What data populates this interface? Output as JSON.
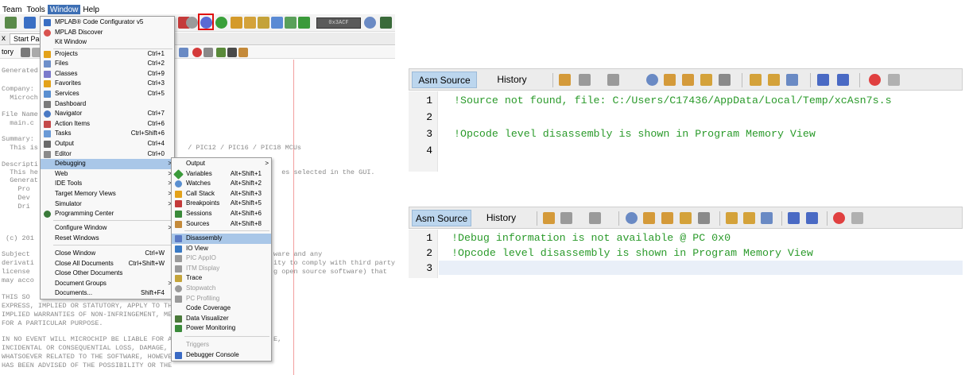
{
  "menubar": {
    "items": [
      {
        "label": "Team"
      },
      {
        "label": "Tools"
      },
      {
        "label": "Window"
      },
      {
        "label": "Help"
      }
    ]
  },
  "tabs": {
    "close": "x",
    "start_page": "Start Page"
  },
  "toolbar2": {
    "label": "tory"
  },
  "toolbar_display": "0x3ACF",
  "editor": {
    "lines": [
      {
        "text": "Generated"
      },
      {
        "text": "Company:"
      },
      {
        "text": "  Microch"
      },
      {
        "text": "File Name"
      },
      {
        "text": "  main.c"
      },
      {
        "text": "Summary:"
      },
      {
        "text": "  This is"
      },
      {
        "text": "  / PIC12 / PIC16 / PIC18 MCUs"
      },
      {
        "text": "Descripti"
      },
      {
        "text": "  This he"
      },
      {
        "text": "  es selected in the GUI."
      },
      {
        "text": "  Generat"
      },
      {
        "text": "    Pro"
      },
      {
        "text": "    Dev"
      },
      {
        "text": "    Dri"
      },
      {
        "text": " (c) 201"
      },
      {
        "text": "Subject "
      },
      {
        "text": "ware and any"
      },
      {
        "text": "derivati"
      },
      {
        "text": "ity to comply with third party"
      },
      {
        "text": "license "
      },
      {
        "text": "g open source software) that"
      },
      {
        "text": "may acco"
      },
      {
        "text": "THIS SO"
      },
      {
        "text": "EXPRESS, IMPLIED OR STATUTORY, APPLY TO THIS"
      },
      {
        "text": "IMPLIED WARRANTIES OF NON-INFRINGEMENT, MER"
      },
      {
        "text": "FOR A PARTICULAR PURPOSE."
      },
      {
        "text": "IN NO EVENT WILL MICROCHIP BE LIABLE FOR AN"
      },
      {
        "text": "E,"
      },
      {
        "text": "INCIDENTAL OR CONSEQUENTIAL LOSS, DAMAGE, C"
      },
      {
        "text": "WHATSOEVER RELATED TO THE SOFTWARE, HOWEVER"
      },
      {
        "text": "HAS BEEN ADVISED OF THE POSSIBILITY OR THE"
      }
    ]
  },
  "window_menu": {
    "items": [
      {
        "label": "MPLAB® Code Configurator v5",
        "shortcut": "",
        "arrow": "",
        "icon": "#3a6fc4"
      },
      {
        "label": "MPLAB Discover",
        "shortcut": "",
        "arrow": "",
        "icon": "#d9534f"
      },
      {
        "label": "Kit Window",
        "shortcut": "",
        "arrow": "",
        "icon": ""
      },
      {
        "label": "Projects",
        "shortcut": "Ctrl+1",
        "arrow": "",
        "icon": "#e3a21a"
      },
      {
        "label": "Files",
        "shortcut": "Ctrl+2",
        "arrow": "",
        "icon": "#6d8fc9"
      },
      {
        "label": "Classes",
        "shortcut": "Ctrl+9",
        "arrow": "",
        "icon": "#7a7acc"
      },
      {
        "label": "Favorites",
        "shortcut": "Ctrl+3",
        "arrow": "",
        "icon": "#e3a21a"
      },
      {
        "label": "Services",
        "shortcut": "Ctrl+5",
        "arrow": "",
        "icon": "#5a8fd0"
      },
      {
        "label": "Dashboard",
        "shortcut": "",
        "arrow": "",
        "icon": "#7a7a7a"
      },
      {
        "label": "Navigator",
        "shortcut": "Ctrl+7",
        "arrow": "",
        "icon": "#4a7ac4"
      },
      {
        "label": "Action Items",
        "shortcut": "Ctrl+6",
        "arrow": "",
        "icon": "#c44a4a"
      },
      {
        "label": "Tasks",
        "shortcut": "Ctrl+Shift+6",
        "arrow": "",
        "icon": "#6a9ad6"
      },
      {
        "label": "Output",
        "shortcut": "Ctrl+4",
        "arrow": "",
        "icon": "#6a6a6a"
      },
      {
        "label": "Editor",
        "shortcut": "Ctrl+0",
        "arrow": "",
        "icon": "#8a8a8a"
      },
      {
        "label": "Debugging",
        "shortcut": "",
        "arrow": ">",
        "icon": "",
        "selected": true
      },
      {
        "label": "Web",
        "shortcut": "",
        "arrow": ">",
        "icon": ""
      },
      {
        "label": "IDE Tools",
        "shortcut": "",
        "arrow": ">",
        "icon": ""
      },
      {
        "label": "Target Memory Views",
        "shortcut": "",
        "arrow": ">",
        "icon": ""
      },
      {
        "label": "Simulator",
        "shortcut": "",
        "arrow": ">",
        "icon": ""
      },
      {
        "label": "Programming Center",
        "shortcut": "",
        "arrow": "",
        "icon": "#3a7a3a"
      },
      {
        "label": "Configure Window",
        "shortcut": "",
        "arrow": ">",
        "icon": ""
      },
      {
        "label": "Reset Windows",
        "shortcut": "",
        "arrow": "",
        "icon": ""
      },
      {
        "label": "Close Window",
        "shortcut": "Ctrl+W",
        "arrow": "",
        "icon": ""
      },
      {
        "label": "Close All Documents",
        "shortcut": "Ctrl+Shift+W",
        "arrow": "",
        "icon": ""
      },
      {
        "label": "Close Other Documents",
        "shortcut": "",
        "arrow": "",
        "icon": ""
      },
      {
        "label": "Document Groups",
        "shortcut": "",
        "arrow": ">",
        "icon": ""
      },
      {
        "label": "Documents...",
        "shortcut": "Shift+F4",
        "arrow": "",
        "icon": ""
      }
    ]
  },
  "debug_menu": {
    "items": [
      {
        "label": "Output",
        "shortcut": "",
        "arrow": ">",
        "icon": ""
      },
      {
        "label": "Variables",
        "shortcut": "Alt+Shift+1",
        "arrow": "",
        "icon": "#3a9a3a"
      },
      {
        "label": "Watches",
        "shortcut": "Alt+Shift+2",
        "arrow": "",
        "icon": "#5a8fd0"
      },
      {
        "label": "Call Stack",
        "shortcut": "Alt+Shift+3",
        "arrow": "",
        "icon": "#e3a21a"
      },
      {
        "label": "Breakpoints",
        "shortcut": "Alt+Shift+5",
        "arrow": "",
        "icon": "#c43a3a"
      },
      {
        "label": "Sessions",
        "shortcut": "Alt+Shift+6",
        "arrow": "",
        "icon": "#3a8a3a"
      },
      {
        "label": "Sources",
        "shortcut": "Alt+Shift+8",
        "arrow": "",
        "icon": "#c48a3a"
      },
      {
        "label": "Disassembly",
        "shortcut": "",
        "arrow": "",
        "icon": "#5a7ac4",
        "selected": true
      },
      {
        "label": "IO View",
        "shortcut": "",
        "arrow": "",
        "icon": "#3a7ac4"
      },
      {
        "label": "PIC AppIO",
        "shortcut": "",
        "arrow": "",
        "icon": "#9a9a9a",
        "disabled": true
      },
      {
        "label": "ITM Display",
        "shortcut": "",
        "arrow": "",
        "icon": "#9a9a9a",
        "disabled": true
      },
      {
        "label": "Trace",
        "shortcut": "",
        "arrow": "",
        "icon": "#c4a43a"
      },
      {
        "label": "Stopwatch",
        "shortcut": "",
        "arrow": "",
        "icon": "#9a9a9a",
        "disabled": true
      },
      {
        "label": "PC Profiling",
        "shortcut": "",
        "arrow": "",
        "icon": "#9a9a9a",
        "disabled": true
      },
      {
        "label": "Code Coverage",
        "shortcut": "",
        "arrow": "",
        "icon": ""
      },
      {
        "label": "Data Visualizer",
        "shortcut": "",
        "arrow": "",
        "icon": "#4a7a3a"
      },
      {
        "label": "Power Monitoring",
        "shortcut": "",
        "arrow": "",
        "icon": "#3a8a3a"
      },
      {
        "label": "Triggers",
        "shortcut": "",
        "arrow": "",
        "icon": "",
        "disabled": true
      },
      {
        "label": "Debugger Console",
        "shortcut": "",
        "arrow": "",
        "icon": "#3a6ac4"
      }
    ]
  },
  "panel1": {
    "tabs": [
      "Asm Source",
      "History"
    ],
    "line_numbers": [
      "1",
      "2",
      "3",
      "4"
    ],
    "lines": [
      "!Source not found, file: C:/Users/C17436/AppData/Local/Temp/xcAsn7s.s",
      "",
      "!Opcode level disassembly is shown in Program Memory View",
      ""
    ]
  },
  "panel2": {
    "tabs": [
      "Asm Source",
      "History"
    ],
    "line_numbers": [
      "1",
      "2",
      "3"
    ],
    "lines": [
      "!Debug information is not available @ PC 0x0",
      "!Opcode level disassembly is shown in Program Memory View",
      ""
    ]
  },
  "colors": {
    "menu_selected": "#a9c7e8",
    "active_tab": "#bcd6ee",
    "code_green": "#2a9a2a",
    "highlight_red": "#e01010",
    "menubar_active": "#3d6fb4"
  }
}
